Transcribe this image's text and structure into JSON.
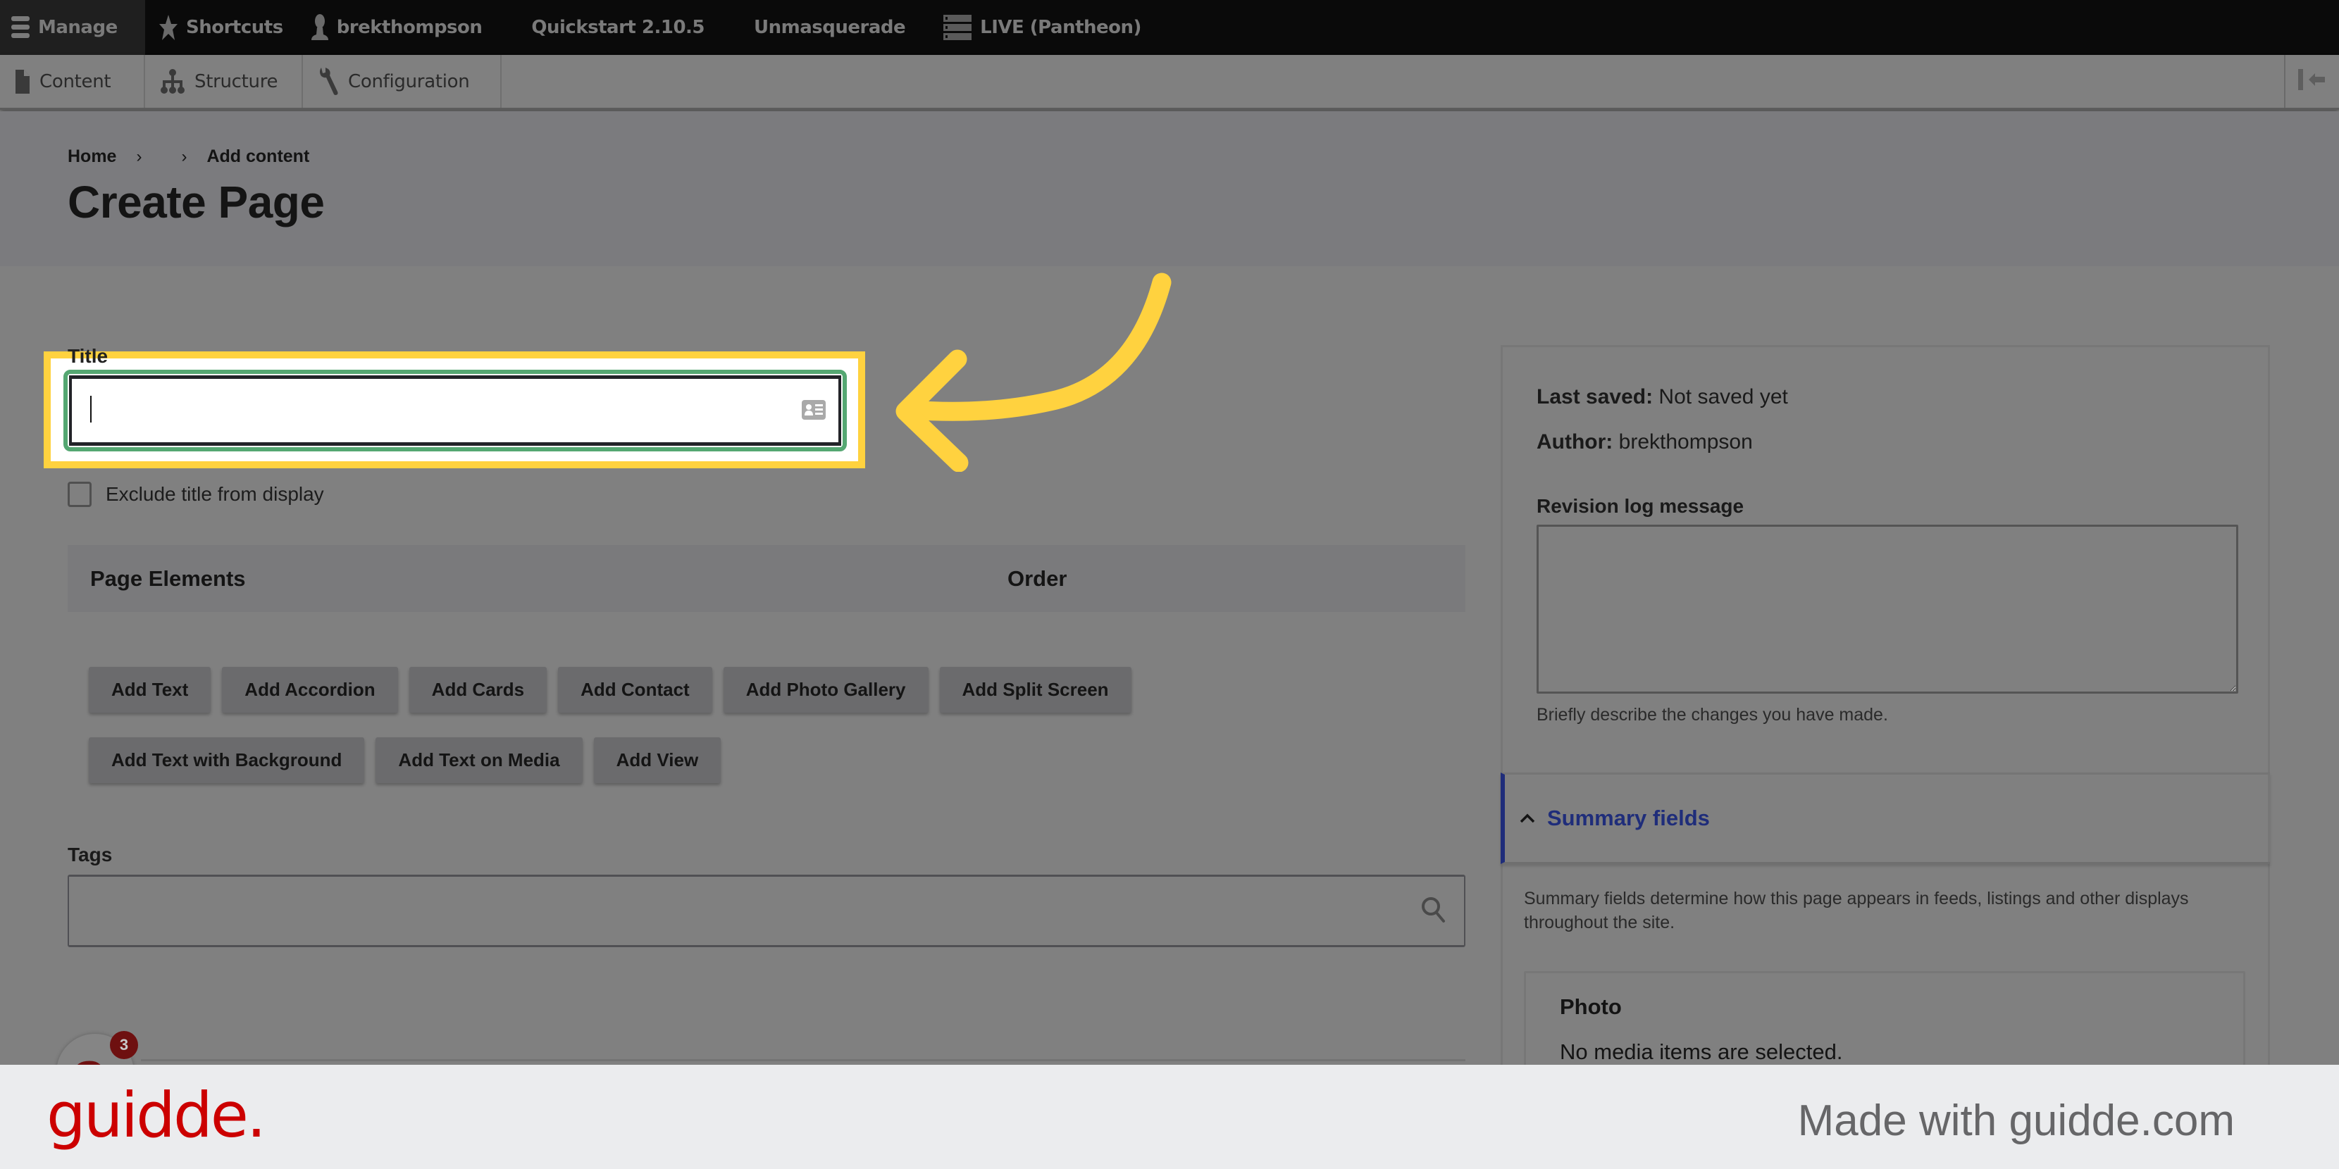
{
  "toolbar": {
    "manage": "Manage",
    "shortcuts": "Shortcuts",
    "user": "brekthompson",
    "quickstart": "Quickstart 2.10.5",
    "unmasquerade": "Unmasquerade",
    "environment": "LIVE (Pantheon)",
    "icons": {
      "manage": "hamburger-icon",
      "shortcuts": "star-icon",
      "user": "person-icon",
      "environment": "server-icon"
    }
  },
  "tray": {
    "items": [
      {
        "label": "Content",
        "icon": "file-icon"
      },
      {
        "label": "Structure",
        "icon": "sitemap-icon"
      },
      {
        "label": "Configuration",
        "icon": "wrench-icon"
      }
    ],
    "collapse_icon": "collapse-left-icon"
  },
  "header": {
    "breadcrumb": [
      "Home",
      "",
      "Add content"
    ],
    "title": "Create Page"
  },
  "form": {
    "title_label": "Title",
    "title_value": "",
    "exclude_title_label": "Exclude title from display",
    "exclude_title_checked": false,
    "page_elements": {
      "col_label": "Page Elements",
      "col_order": "Order"
    },
    "add_buttons_row1": [
      "Add Text",
      "Add Accordion",
      "Add Cards",
      "Add Contact",
      "Add Photo Gallery",
      "Add Split Screen"
    ],
    "add_buttons_row2": [
      "Add Text with Background",
      "Add Text on Media",
      "Add View"
    ],
    "tags_label": "Tags",
    "tags_value": ""
  },
  "sidebar": {
    "last_saved_label": "Last saved:",
    "last_saved_value": "Not saved yet",
    "author_label": "Author:",
    "author_value": "brekthompson",
    "revision_label": "Revision log message",
    "revision_value": "",
    "revision_desc": "Briefly describe the changes you have made.",
    "summary_title": "Summary fields",
    "summary_desc": "Summary fields determine how this page appears in feeds, listings and other displays throughout the site.",
    "photo_title": "Photo",
    "photo_empty": "No media items are selected."
  },
  "floating": {
    "badge_count": "3",
    "glyph": "a"
  },
  "footer": {
    "logo": "guidde.",
    "tagline": "Made with guidde.com"
  },
  "colors": {
    "highlight": "#ffd23f",
    "focus_ring": "#55a772",
    "summary_accent": "#1f2d7a",
    "brand_red": "#cc0000"
  }
}
